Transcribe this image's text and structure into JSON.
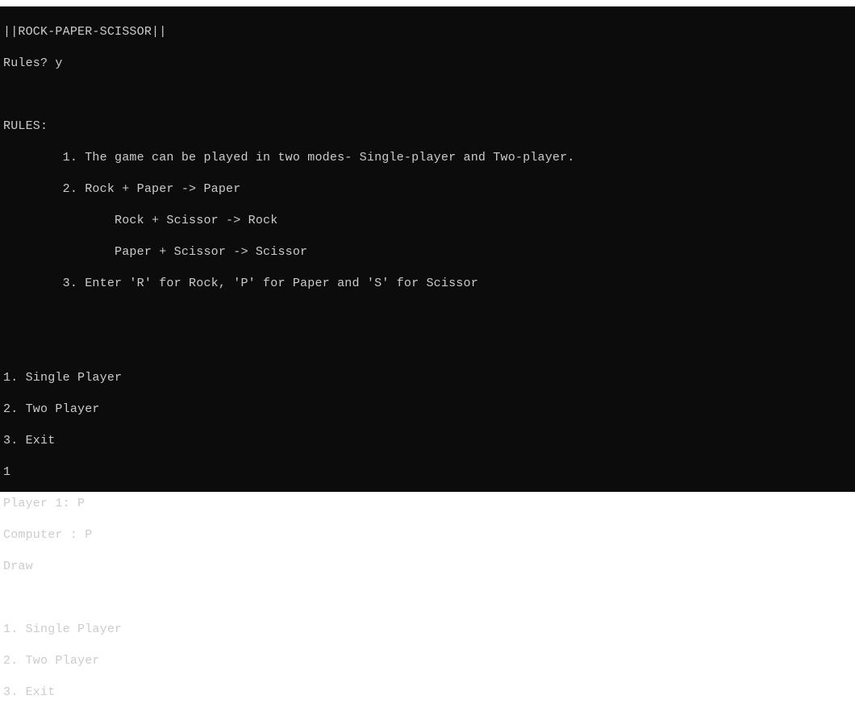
{
  "title_bar": {
    "visible": true
  },
  "terminal": {
    "header": "||ROCK-PAPER-SCISSOR||",
    "rules_prompt": "Rules? y",
    "blank1": "",
    "rules_header": "RULES:",
    "rule1": "        1. The game can be played in two modes- Single-player and Two-player.",
    "rule2": "        2. Rock + Paper -> Paper",
    "rule2b": "               Rock + Scissor -> Rock",
    "rule2c": "               Paper + Scissor -> Scissor",
    "rule3": "        3. Enter 'R' for Rock, 'P' for Paper and 'S' for Scissor",
    "blank2": "",
    "blank3": "",
    "menu1_opt1": "1. Single Player",
    "menu1_opt2": "2. Two Player",
    "menu1_opt3": "3. Exit",
    "input_choice": "1",
    "player1_line": "Player 1: P",
    "computer_line": "Computer : P",
    "result_line": "Draw",
    "blank4": "",
    "menu2_opt1": "1. Single Player",
    "menu2_opt2": "2. Two Player",
    "menu2_opt3": "3. Exit"
  }
}
